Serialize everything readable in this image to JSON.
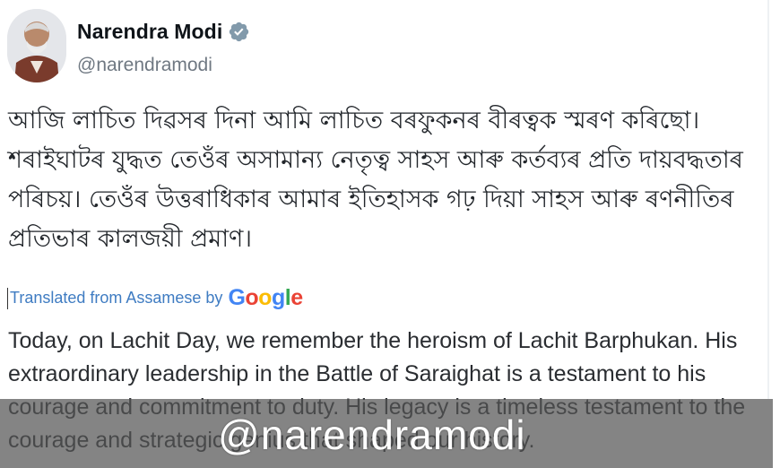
{
  "author": {
    "display_name": "Narendra Modi",
    "handle": "@narendramodi",
    "verified_icon": "verified-badge-icon",
    "verified_color": "#829aab"
  },
  "post": {
    "original_text": "আজি লাচিত দিৱসৰ দিনা আমি লাচিত বৰফুকনৰ বীৰত্বক স্মৰণ কৰিছো। শৰাইঘাটৰ যুদ্ধত তেওঁৰ অসামান্য নেতৃত্ব সাহস আৰু কৰ্তব্যৰ প্ৰতি দায়বদ্ধতাৰ পৰিচয়। তেওঁৰ উত্তৰাধিকাৰ আমাৰ ইতিহাসক গঢ় দিয়া সাহস আৰু ৰণনীতিৰ প্ৰতিভাৰ কালজয়ী প্ৰমাণ।",
    "translated_label": "Translated from Assamese by",
    "translator_brand": "Google",
    "translation_text": "Today, on Lachit Day, we remember the heroism of Lachit Barphukan. His extraordinary leadership in the Battle of Saraighat is a testament to his courage and commitment to duty. His legacy is a timeless testament to the courage and strategic genius that shaped our history."
  },
  "watermark": {
    "text": "@narendramodi"
  },
  "colors": {
    "link_blue": "#3f7cc2",
    "google_blue": "#4285F4",
    "google_red": "#EA4335",
    "google_yellow": "#FBBC05",
    "google_green": "#34A853"
  }
}
